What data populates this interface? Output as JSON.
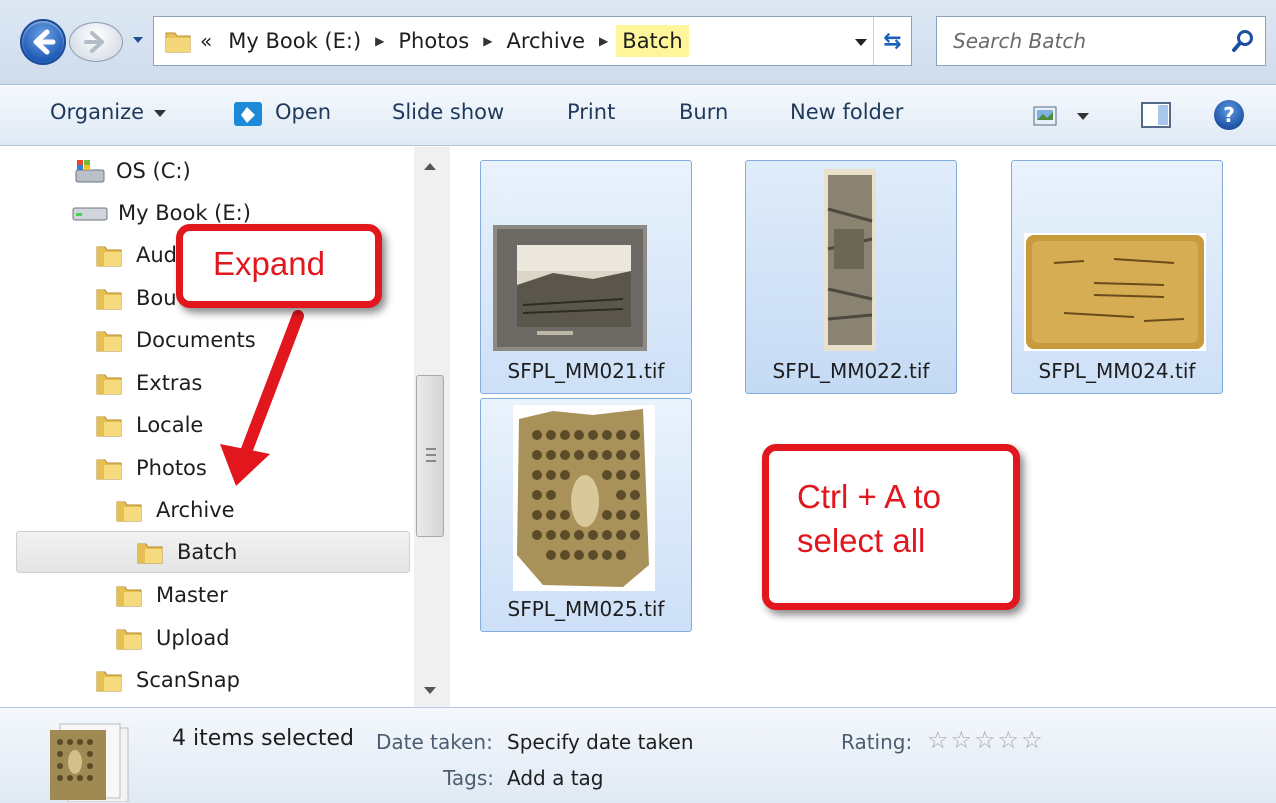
{
  "address": {
    "overflow": "«",
    "crumbs": [
      "My Book (E:)",
      "Photos",
      "Archive",
      "Batch"
    ],
    "search_placeholder": "Search Batch"
  },
  "toolbar": {
    "organize": "Organize",
    "open": "Open",
    "slideshow": "Slide show",
    "print": "Print",
    "burn": "Burn",
    "new_folder": "New folder"
  },
  "tree": {
    "os": "OS (C:)",
    "mybook": "My Book (E:)",
    "audio": "Aud",
    "bound": "Bou",
    "documents": "Documents",
    "extras": "Extras",
    "locale": "Locale",
    "photos": "Photos",
    "archive": "Archive",
    "batch": "Batch",
    "master": "Master",
    "upload": "Upload",
    "scansnap": "ScanSnap"
  },
  "files": [
    {
      "name": "SFPL_MM021.tif"
    },
    {
      "name": "SFPL_MM022.tif"
    },
    {
      "name": "SFPL_MM024.tif"
    },
    {
      "name": "SFPL_MM025.tif"
    }
  ],
  "callouts": {
    "expand": "Expand",
    "select_line1": "Ctrl + A to",
    "select_line2": "select all"
  },
  "details": {
    "count": "4 items selected",
    "date_label": "Date taken:",
    "date_value": "Specify date taken",
    "tags_label": "Tags:",
    "tags_value": "Add a tag",
    "rating_label": "Rating:"
  },
  "colors": {
    "callout_red": "#e2161d",
    "crumb_highlight": "#fff59a",
    "selection_blue": "#cde0f7"
  }
}
